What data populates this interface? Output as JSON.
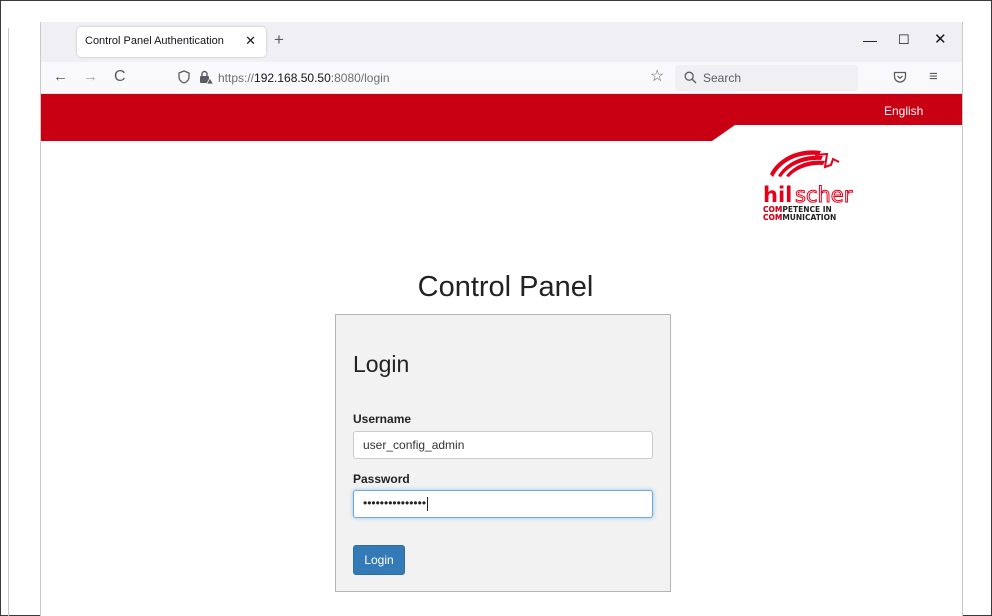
{
  "tab": {
    "title": "Control Panel Authentication",
    "close_glyph": "✕",
    "new_tab_glyph": "+"
  },
  "window_controls": {
    "minimize": "—",
    "maximize": "☐",
    "close": "✕"
  },
  "nav": {
    "back_glyph": "←",
    "forward_glyph": "→",
    "reload_glyph": "C",
    "url_scheme": "https://",
    "url_host": "192.168.50.50",
    "url_rest": ":8080/login",
    "bookmark_glyph": "☆",
    "search_placeholder": "Search",
    "menu_glyph": "≡"
  },
  "header": {
    "language_link": "English",
    "brand_color": "#c90014"
  },
  "logo": {
    "name": "hilscher",
    "tagline_line1": "COMPETENCE IN",
    "tagline_line2": "COMMUNICATION"
  },
  "page": {
    "title": "Control Panel"
  },
  "login": {
    "heading": "Login",
    "username_label": "Username",
    "username_value": "user_config_admin",
    "password_label": "Password",
    "password_value": "•••••••••••••••",
    "submit_label": "Login",
    "accent_color": "#337ab7"
  },
  "icons": [
    "shield-icon",
    "lock-icon",
    "star-icon",
    "search-icon",
    "pocket-icon",
    "menu-icon"
  ]
}
